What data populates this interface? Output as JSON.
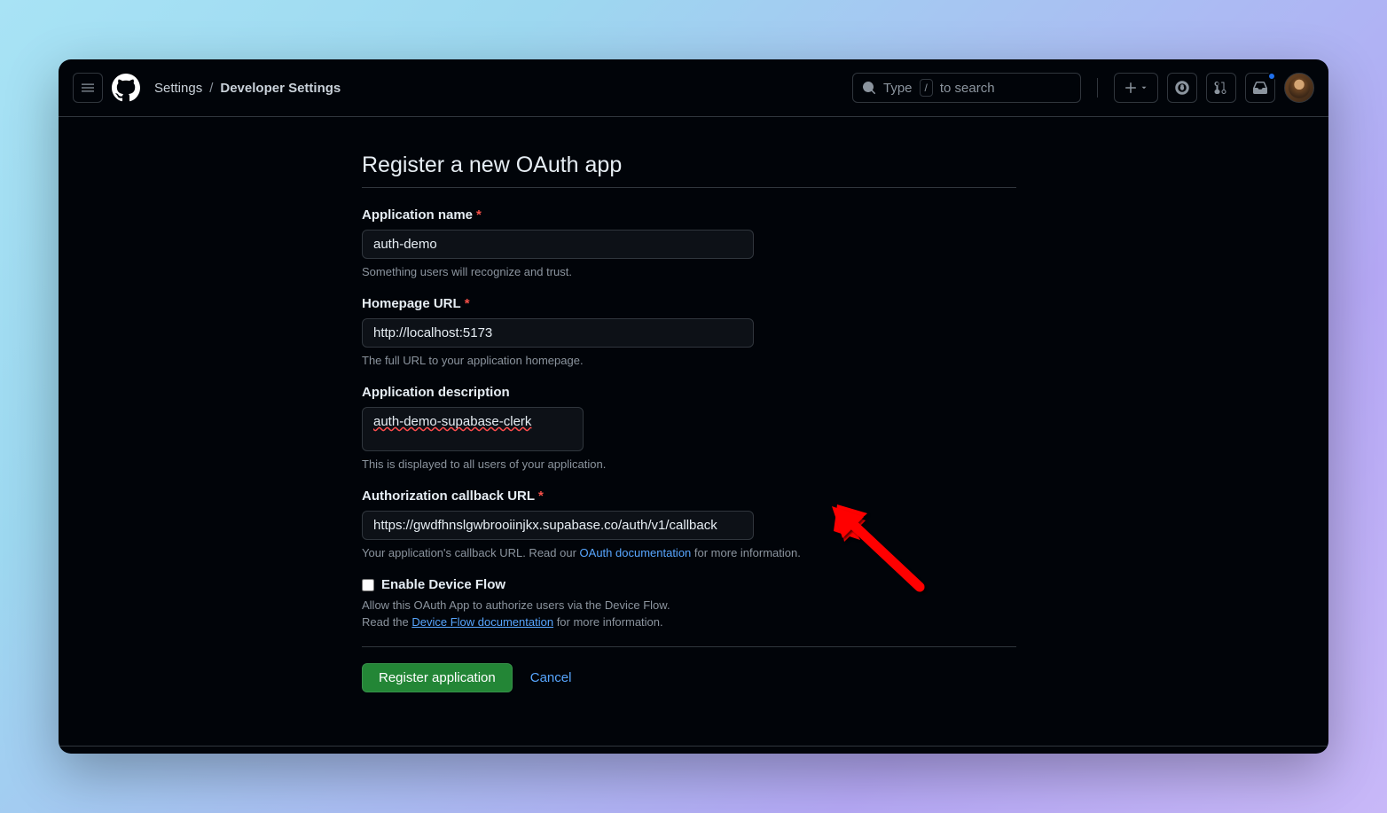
{
  "breadcrumb": {
    "settings": "Settings",
    "current": "Developer Settings"
  },
  "search": {
    "prefix": "Type",
    "kbd": "/",
    "suffix": "to search"
  },
  "page": {
    "title": "Register a new OAuth app"
  },
  "form": {
    "appName": {
      "label": "Application name",
      "value": "auth-demo",
      "help": "Something users will recognize and trust."
    },
    "homepage": {
      "label": "Homepage URL",
      "value": "http://localhost:5173",
      "help": "The full URL to your application homepage."
    },
    "description": {
      "label": "Application description",
      "value": "auth-demo-supabase-clerk",
      "help": "This is displayed to all users of your application."
    },
    "callback": {
      "label": "Authorization callback URL",
      "value": "https://gwdfhnslgwbrooiinjkx.supabase.co/auth/v1/callback",
      "helpPrefix": "Your application's callback URL. Read our ",
      "helpLink": "OAuth documentation",
      "helpSuffix": " for more information."
    },
    "deviceFlow": {
      "label": "Enable Device Flow",
      "checked": false,
      "help1": "Allow this OAuth App to authorize users via the Device Flow.",
      "help2Prefix": "Read the ",
      "help2Link": "Device Flow documentation",
      "help2Suffix": " for more information."
    }
  },
  "actions": {
    "register": "Register application",
    "cancel": "Cancel"
  }
}
